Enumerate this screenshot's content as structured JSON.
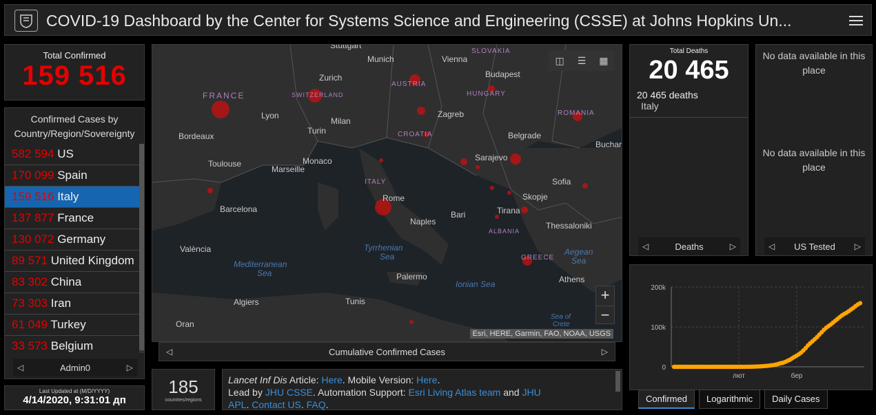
{
  "header": {
    "title": "COVID-19 Dashboard by the Center for Systems Science and Engineering (CSSE) at Johns Hopkins Un..."
  },
  "total_confirmed": {
    "label": "Total Confirmed",
    "value": "159 516"
  },
  "country_list": {
    "heading": "Confirmed Cases by Country/Region/Sovereignty",
    "items": [
      {
        "num": "582 594",
        "name": "US"
      },
      {
        "num": "170 099",
        "name": "Spain"
      },
      {
        "num": "159 516",
        "name": "Italy",
        "selected": true
      },
      {
        "num": "137 877",
        "name": "France"
      },
      {
        "num": "130 072",
        "name": "Germany"
      },
      {
        "num": "89 571",
        "name": "United Kingdom"
      },
      {
        "num": "83 302",
        "name": "China"
      },
      {
        "num": "73 303",
        "name": "Iran"
      },
      {
        "num": "61 049",
        "name": "Turkey"
      },
      {
        "num": "33 573",
        "name": "Belgium"
      }
    ],
    "pager_label": "Admin0"
  },
  "last_updated": {
    "label": "Last Updated at (M/D/YYYY)",
    "value": "4/14/2020, 9:31:01 дп"
  },
  "map": {
    "footer_label": "Cumulative Confirmed Cases",
    "attribution": "Esri, HERE, Garmin, FAO, NOAA, USGS",
    "zoom_in": "+",
    "zoom_out": "−",
    "labels": [
      {
        "text": "Stuttgart"
      },
      {
        "text": "Munich"
      },
      {
        "text": "Vienna"
      },
      {
        "text": "SLOVAKIA"
      },
      {
        "text": "FRANCE"
      },
      {
        "text": "Zurich"
      },
      {
        "text": "SWITZERLAND"
      },
      {
        "text": "AUSTRIA"
      },
      {
        "text": "Budapest"
      },
      {
        "text": "HUNGARY"
      },
      {
        "text": "Lyon"
      },
      {
        "text": "Milan"
      },
      {
        "text": "Zagreb"
      },
      {
        "text": "ROMANIA"
      },
      {
        "text": "Bordeaux"
      },
      {
        "text": "Turin"
      },
      {
        "text": "CROATIA"
      },
      {
        "text": "Belgrade"
      },
      {
        "text": "Buchar"
      },
      {
        "text": "Toulouse"
      },
      {
        "text": "Marseille"
      },
      {
        "text": "Monaco"
      },
      {
        "text": "Sarajevo"
      },
      {
        "text": "ITALY"
      },
      {
        "text": "Sofia"
      },
      {
        "text": "Barcelona"
      },
      {
        "text": "Rome"
      },
      {
        "text": "Skopje"
      },
      {
        "text": "Tirana"
      },
      {
        "text": "Bari"
      },
      {
        "text": "Naples"
      },
      {
        "text": "ALBANIA"
      },
      {
        "text": "Thessaloniki"
      },
      {
        "text": "València"
      },
      {
        "text": "Tyrrhenian"
      },
      {
        "text": "Sea"
      },
      {
        "text": "Mediterranean"
      },
      {
        "text": "Sea"
      },
      {
        "text": "Aegean"
      },
      {
        "text": "Sea"
      },
      {
        "text": "GREECE"
      },
      {
        "text": "Palermo"
      },
      {
        "text": "Ionian Sea"
      },
      {
        "text": "Athens"
      },
      {
        "text": "Algiers"
      },
      {
        "text": "Tunis"
      },
      {
        "text": "Oran"
      },
      {
        "text": "Sea of"
      },
      {
        "text": "Crete"
      }
    ]
  },
  "countries_count": {
    "value": "185",
    "label": "countries/regions"
  },
  "info": {
    "line1_a": "Lancet Inf Dis",
    "line1_b": " Article: ",
    "line1_link1": "Here",
    "line1_c": ". Mobile Version: ",
    "line1_link2": "Here",
    "line1_d": ".",
    "line2_a": "Lead by ",
    "line2_link1": "JHU CSSE",
    "line2_b": ". Automation Support: ",
    "line2_link2": "Esri Living Atlas team",
    "line2_c": " and ",
    "line2_link3": "JHU",
    "line3_link1": "APL",
    "line3_a": ". ",
    "line3_link2": "Contact US",
    "line3_b": ". ",
    "line3_link3": "FAQ",
    "line3_c": "."
  },
  "deaths": {
    "label": "Total Deaths",
    "value": "20 465",
    "sub_number": "20 465",
    "sub_label": " deaths",
    "location": "Italy",
    "pager_label": "Deaths"
  },
  "tested": {
    "msg1": "No data available in this place",
    "msg2": "No data available in this place",
    "pager_label": "US Tested"
  },
  "chart_data": {
    "type": "line",
    "title": "",
    "xlabel": "",
    "ylabel": "",
    "y_ticks": [
      "0",
      "100k",
      "200k"
    ],
    "x_ticks": [
      "лют",
      "бер"
    ],
    "ylim": [
      0,
      200000
    ],
    "series": [
      {
        "color": "#ffa500",
        "values": [
          0,
          0,
          0,
          0,
          0,
          0,
          0,
          0,
          0,
          0,
          0,
          0,
          0,
          0,
          0,
          0,
          0,
          0,
          0,
          0,
          0,
          0,
          0,
          0,
          0,
          0,
          0,
          0,
          0,
          3,
          20,
          80,
          150,
          230,
          320,
          450,
          650,
          890,
          1130,
          1690,
          2040,
          2500,
          3090,
          3860,
          4640,
          5880,
          7380,
          9170,
          10150,
          12460,
          15110,
          17660,
          21150,
          24750,
          27980,
          31500,
          35710,
          41040,
          47020,
          53580,
          59140,
          63930,
          69180,
          74390,
          80590,
          86500,
          92470,
          97690,
          101740,
          105790,
          110570,
          115240,
          119830,
          124630,
          128950,
          132550,
          135590,
          139420,
          143630,
          147580,
          152270,
          156360,
          159520
        ]
      }
    ]
  },
  "chart_tabs": {
    "tab1": "Confirmed",
    "tab2": "Logarithmic",
    "tab3": "Daily Cases"
  }
}
